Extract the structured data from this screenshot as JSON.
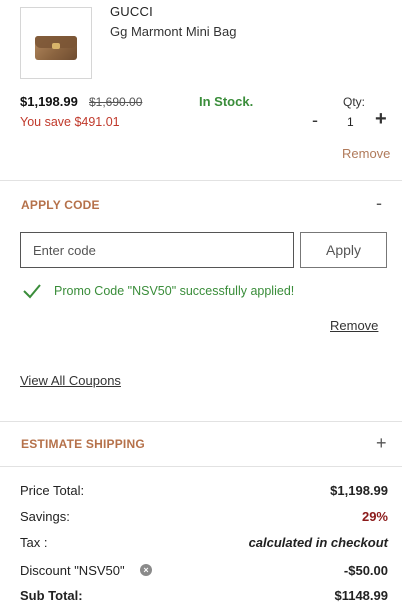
{
  "item": {
    "brand": "GUCCI",
    "name": "Gg Marmont Mini Bag",
    "price": "$1,198.99",
    "original_price": "$1,690.00",
    "savings_text": "You save $491.01",
    "stock": "In Stock.",
    "qty_label": "Qty:",
    "qty_minus": "-",
    "qty_value": "1",
    "qty_plus": "+",
    "remove_label": "Remove"
  },
  "apply_code": {
    "title": "APPLY CODE",
    "toggle": "-",
    "input_placeholder": "Enter code",
    "apply_label": "Apply",
    "success_message": "Promo Code \"NSV50\" successfully applied!",
    "remove_label": "Remove",
    "view_coupons": "View All Coupons"
  },
  "estimate_shipping": {
    "title": "ESTIMATE SHIPPING",
    "toggle": "+"
  },
  "summary": {
    "price_total_label": "Price Total:",
    "price_total_value": "$1,198.99",
    "savings_label": "Savings:",
    "savings_value": "29%",
    "tax_label": "Tax :",
    "tax_value": "calculated in checkout",
    "discount_label": "Discount \"NSV50\"",
    "discount_value": "-$50.00",
    "subtotal_label": "Sub Total:",
    "subtotal_value": "$1148.99"
  },
  "colors": {
    "accent": "#b5714a",
    "success": "#3a8d3a",
    "danger": "#c0392b"
  },
  "icons": {
    "check": "check-icon",
    "info": "close-circle-icon"
  }
}
